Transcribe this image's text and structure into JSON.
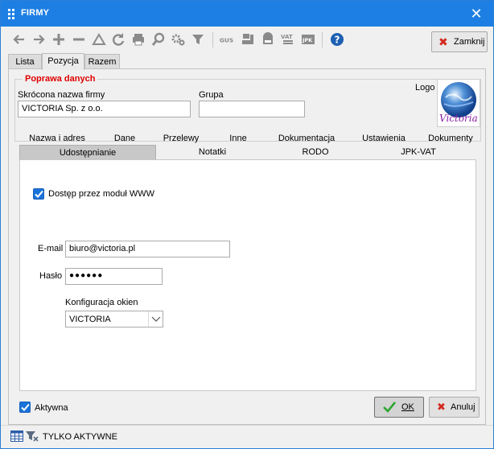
{
  "window": {
    "title": "FIRMY",
    "close_glyph": "✕"
  },
  "toolbar": {
    "icons": [
      "arrow-left-icon",
      "arrow-right-icon",
      "plus-icon",
      "minus-icon",
      "triangle-icon",
      "refresh-icon",
      "print-icon",
      "zoom-icon",
      "gear-icon",
      "filter-icon",
      "gus-icon",
      "stamp-icon",
      "save-disk-icon",
      "vat-icon",
      "jpk-icon",
      "help-icon"
    ],
    "close_label": "Zamknij"
  },
  "outer_tabs": [
    {
      "label": "Lista"
    },
    {
      "label": "Pozycja"
    },
    {
      "label": "Razem"
    }
  ],
  "form": {
    "section_title": "Poprawa danych",
    "short_name_label": "Skrócona nazwa firmy",
    "short_name_value": "VICTORIA Sp. z o.o.",
    "group_label": "Grupa",
    "group_value": "",
    "logo_label": "Logo",
    "logo_text": "Victoria"
  },
  "inner_tabs": {
    "row1": [
      "Nazwa i adres",
      "Dane",
      "Przelewy",
      "Inne",
      "Dokumentacja",
      "Ustawienia",
      "Dokumenty"
    ],
    "row2": [
      "Udostępnianie",
      "Notatki",
      "RODO",
      "JPK-VAT"
    ]
  },
  "sharing": {
    "www_access_label": "Dostęp przez moduł WWW",
    "www_access_checked": true,
    "email_label": "E-mail",
    "email_value": "biuro@victoria.pl",
    "password_label": "Hasło",
    "password_value": "●●●●●●",
    "window_config_label": "Konfiguracja okien",
    "window_config_value": "VICTORIA"
  },
  "footer": {
    "active_label": "Aktywna",
    "active_checked": true,
    "ok_label": "OK",
    "cancel_label": "Anuluj"
  },
  "status": {
    "text": "TYLKO AKTYWNE"
  },
  "colors": {
    "title_bar": "#1d7fe3",
    "accent_red": "#e00000",
    "checkbox_blue": "#1a73d9",
    "ok_green": "#2fa52f",
    "cancel_red": "#d42a1e"
  }
}
